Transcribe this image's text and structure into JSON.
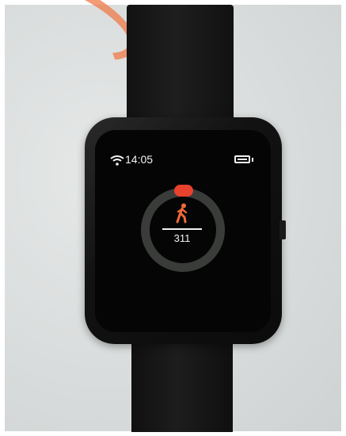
{
  "watch": {
    "status_bar": {
      "time": "14:05",
      "wifi_icon": "wifi-icon",
      "battery_icon": "battery-icon"
    },
    "activity": {
      "icon": "walking-person-icon",
      "steps": "311",
      "accent_color": "#e8412e",
      "ring_color": "#3a3c3a"
    }
  }
}
